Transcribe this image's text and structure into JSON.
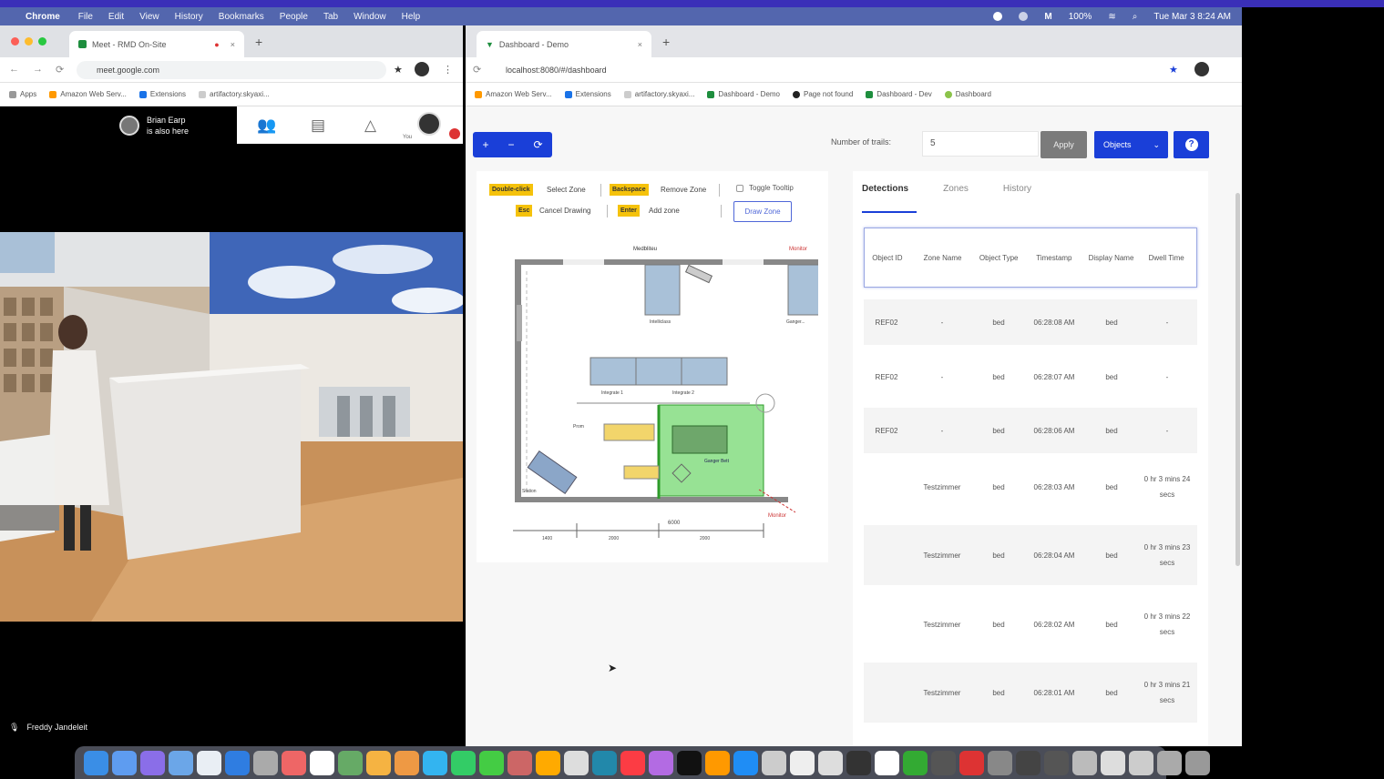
{
  "menubar": {
    "app": "Chrome",
    "items": [
      "File",
      "Edit",
      "View",
      "History",
      "Bookmarks",
      "People",
      "Tab",
      "Window",
      "Help"
    ],
    "battery": "100%",
    "datetime": "Tue Mar 3 8:24 AM"
  },
  "meet_window": {
    "tab_title": "Meet - RMD On-Site",
    "url": "meet.google.com",
    "bookmarks": [
      "Apps",
      "Amazon Web Serv...",
      "Extensions",
      "artifactory.skyaxi..."
    ],
    "presenter": {
      "name": "Brian Earp",
      "status": "is also here"
    },
    "self_label": "You",
    "participant_name": "Freddy Jandeleit"
  },
  "dashboard_window": {
    "tab_title": "Dashboard - Demo",
    "url": "localhost:8080/#/dashboard",
    "bookmarks": [
      "Amazon Web Serv...",
      "Extensions",
      "artifactory.skyaxi...",
      "Dashboard - Demo",
      "Page not found",
      "Dashboard - Dev",
      "Dashboard"
    ]
  },
  "toolbar": {
    "zoom_in": "+",
    "zoom_out": "−",
    "reset": "⟳",
    "num_trails_label": "Number of trails:",
    "num_trails_value": "5",
    "apply_label": "Apply",
    "objects_label": "Objects",
    "help_icon": "?"
  },
  "zone_tools": {
    "rows": [
      [
        {
          "key": "Double-click",
          "label": "Select Zone"
        },
        {
          "key": "Backspace",
          "label": "Remove Zone"
        }
      ],
      [
        {
          "key": "Esc",
          "label": "Cancel Drawing"
        },
        {
          "key": "Enter",
          "label": "Add zone"
        }
      ]
    ],
    "toggle_tooltip": "Toggle Tooltip",
    "draw_zone": "Draw Zone"
  },
  "floorplan": {
    "labels": {
      "top": "Medbliteu",
      "top_right": "Monitor",
      "bed_left": "Intelliclass",
      "bed_right": "Ganger...",
      "row_left": "Integrate 1",
      "row_right": "Integrate 2",
      "cart": "Prom",
      "zone": "Ganger Bett",
      "station": "Station",
      "arrow_label": "Monitor",
      "dim_center": "6000",
      "dim_1": "1400",
      "dim_2": "2000",
      "dim_3": "2000"
    },
    "zone_color": "#5fd35a"
  },
  "detections": {
    "tabs": [
      "Detections",
      "Zones",
      "History"
    ],
    "active_tab": "Detections",
    "columns": [
      "Object ID",
      "Zone Name",
      "Object Type",
      "Timestamp",
      "Display Name",
      "Dwell Time"
    ],
    "rows": [
      {
        "id": "REF02",
        "zone": "-",
        "type": "bed",
        "ts": "06:28:08 AM",
        "display": "bed",
        "dwell": "-"
      },
      {
        "id": "REF02",
        "zone": "-",
        "type": "bed",
        "ts": "06:28:07 AM",
        "display": "bed",
        "dwell": "-"
      },
      {
        "id": "REF02",
        "zone": "-",
        "type": "bed",
        "ts": "06:28:06 AM",
        "display": "bed",
        "dwell": "-"
      },
      {
        "id": "",
        "zone": "Testzimmer",
        "type": "bed",
        "ts": "06:28:03 AM",
        "display": "bed",
        "dwell": "0 hr 3 mins 24 secs"
      },
      {
        "id": "",
        "zone": "Testzimmer",
        "type": "bed",
        "ts": "06:28:04 AM",
        "display": "bed",
        "dwell": "0 hr 3 mins 23 secs"
      },
      {
        "id": "",
        "zone": "Testzimmer",
        "type": "bed",
        "ts": "06:28:02 AM",
        "display": "bed",
        "dwell": "0 hr 3 mins 22 secs"
      },
      {
        "id": "",
        "zone": "Testzimmer",
        "type": "bed",
        "ts": "06:28:01 AM",
        "display": "bed",
        "dwell": "0 hr 3 mins 21 secs"
      }
    ]
  },
  "colors": {
    "menubar": "#5366ae",
    "accent": "#1a3fd8",
    "highlight": "#f5c20b",
    "apply": "#7b7b7b"
  }
}
